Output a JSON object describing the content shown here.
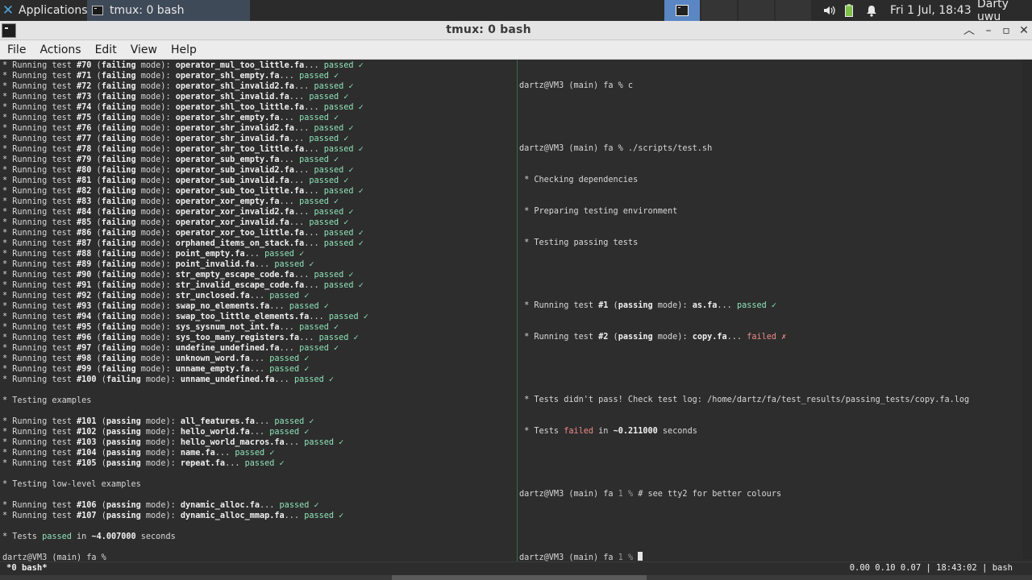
{
  "panel": {
    "apps_label": "Applications",
    "task_label": "tmux: 0 bash",
    "clock": "Fri  1 Jul, 18:43",
    "user": "Darty uwu"
  },
  "window": {
    "title": "tmux: 0 bash"
  },
  "menubar": {
    "items": [
      "File",
      "Actions",
      "Edit",
      "View",
      "Help"
    ]
  },
  "left_pane": {
    "failing_tests": [
      {
        "num": "#70",
        "name": "operator_mul_too_little.fa"
      },
      {
        "num": "#71",
        "name": "operator_shl_empty.fa"
      },
      {
        "num": "#72",
        "name": "operator_shl_invalid2.fa"
      },
      {
        "num": "#73",
        "name": "operator_shl_invalid.fa"
      },
      {
        "num": "#74",
        "name": "operator_shl_too_little.fa"
      },
      {
        "num": "#75",
        "name": "operator_shr_empty.fa"
      },
      {
        "num": "#76",
        "name": "operator_shr_invalid2.fa"
      },
      {
        "num": "#77",
        "name": "operator_shr_invalid.fa"
      },
      {
        "num": "#78",
        "name": "operator_shr_too_little.fa"
      },
      {
        "num": "#79",
        "name": "operator_sub_empty.fa"
      },
      {
        "num": "#80",
        "name": "operator_sub_invalid2.fa"
      },
      {
        "num": "#81",
        "name": "operator_sub_invalid.fa"
      },
      {
        "num": "#82",
        "name": "operator_sub_too_little.fa"
      },
      {
        "num": "#83",
        "name": "operator_xor_empty.fa"
      },
      {
        "num": "#84",
        "name": "operator_xor_invalid2.fa"
      },
      {
        "num": "#85",
        "name": "operator_xor_invalid.fa"
      },
      {
        "num": "#86",
        "name": "operator_xor_too_little.fa"
      },
      {
        "num": "#87",
        "name": "orphaned_items_on_stack.fa"
      },
      {
        "num": "#88",
        "name": "point_empty.fa"
      },
      {
        "num": "#89",
        "name": "point_invalid.fa"
      },
      {
        "num": "#90",
        "name": "str_empty_escape_code.fa"
      },
      {
        "num": "#91",
        "name": "str_invalid_escape_code.fa"
      },
      {
        "num": "#92",
        "name": "str_unclosed.fa"
      },
      {
        "num": "#93",
        "name": "swap_no_elements.fa"
      },
      {
        "num": "#94",
        "name": "swap_too_little_elements.fa"
      },
      {
        "num": "#95",
        "name": "sys_sysnum_not_int.fa"
      },
      {
        "num": "#96",
        "name": "sys_too_many_registers.fa"
      },
      {
        "num": "#97",
        "name": "undefine_undefined.fa"
      },
      {
        "num": "#98",
        "name": "unknown_word.fa"
      },
      {
        "num": "#99",
        "name": "unname_empty.fa"
      },
      {
        "num": "#100",
        "name": "unname_undefined.fa"
      }
    ],
    "examples_heading": "* Testing examples",
    "example_tests": [
      {
        "num": "#101",
        "name": "all_features.fa"
      },
      {
        "num": "#102",
        "name": "hello_world.fa"
      },
      {
        "num": "#103",
        "name": "hello_world_macros.fa"
      },
      {
        "num": "#104",
        "name": "name.fa"
      },
      {
        "num": "#105",
        "name": "repeat.fa"
      }
    ],
    "lowlevel_heading": "* Testing low-level examples",
    "lowlevel_tests": [
      {
        "num": "#106",
        "name": "dynamic_alloc.fa"
      },
      {
        "num": "#107",
        "name": "dynamic_alloc_mmap.fa"
      }
    ],
    "summary_prefix": "* Tests ",
    "summary_status": "passed",
    "summary_mid": " in ",
    "summary_time": "~4.007000",
    "summary_suffix": " seconds",
    "prompt": "dartz@VM3 (main) fa %",
    "line_prefix": "* Running test ",
    "failing_mode": "failing",
    "passing_mode": "passing",
    "mode_word": " mode): ",
    "passed_word": "passed",
    "check": "✓",
    "ellipsis": "..."
  },
  "right_pane": {
    "prompt1": "dartz@VM3 (main) fa % c",
    "prompt2": "dartz@VM3 (main) fa % ./scripts/test.sh",
    "step1": " * Checking dependencies",
    "step2": " * Preparing testing environment",
    "step3": " * Testing passing tests",
    "test1_num": "#1",
    "test1_name": "as.fa",
    "test1_status": "passed ✓",
    "test2_num": "#2",
    "test2_name": "copy.fa",
    "test2_status": "failed ✗",
    "fail_msg": " * Tests didn't pass! Check test log: /home/dartz/fa/test_results/passing_tests/copy.fa.log",
    "fail_time": "~0.211000",
    "prompt3_main": "dartz@VM3 (main) fa ",
    "prompt3_code": "1 %",
    "prompt3_cmd": " # see tty2 for better colours",
    "prompt4_main": "dartz@VM3 (main) fa ",
    "prompt4_code": "1 %"
  },
  "statusbar": {
    "window_label": "*0 bash*",
    "right": "0.00 0.10 0.07 | 18:43:02 | bash"
  }
}
